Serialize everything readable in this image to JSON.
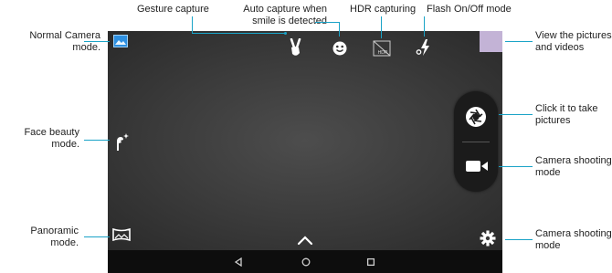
{
  "callouts": {
    "normal_camera": "Normal Camera\nmode.",
    "face_beauty": "Face beauty\nmode.",
    "panoramic": "Panoramic\nmode.",
    "gesture": "Gesture capture",
    "smile": "Auto capture when\nsmile is detected",
    "hdr": "HDR capturing",
    "flash": "Flash On/Off mode",
    "view": "View the pictures\nand videos",
    "take": "Click it to take\npictures",
    "video": "Camera shooting\nmode",
    "settings": "Camera shooting\nmode"
  },
  "icons": {
    "normal_camera": "landscape-icon",
    "face_beauty": "face-beauty-icon",
    "panoramic": "panorama-icon",
    "gesture": "victory-hand-icon",
    "smile": "smile-face-icon",
    "hdr": "hdr-icon",
    "flash": "flash-auto-icon",
    "shutter": "camera-shutter-icon",
    "video": "video-camera-icon",
    "settings": "gear-icon",
    "expand": "chevron-up-icon",
    "nav_back": "triangle-back-icon",
    "nav_home": "circle-home-icon",
    "nav_recent": "square-recent-icon"
  },
  "colors": {
    "accent": "#1aa3c7",
    "gallery_thumbnail": "#c3b3d6"
  }
}
